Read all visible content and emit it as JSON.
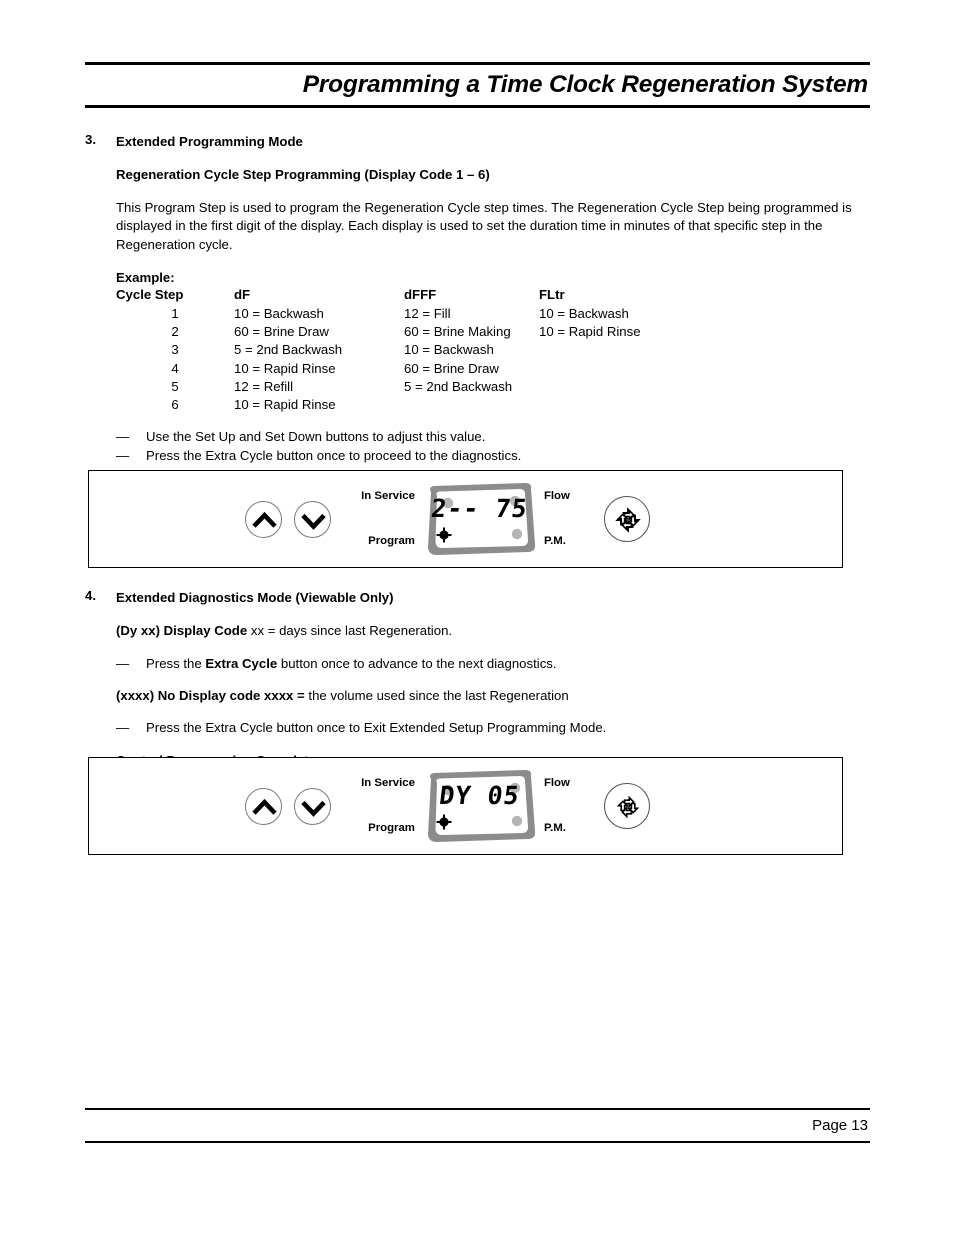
{
  "header": {
    "title": "Programming a Time Clock Regeneration System"
  },
  "section3": {
    "number": "3.",
    "heading": "Extended Programming Mode",
    "subheading": "Regeneration Cycle Step Programming (Display Code 1 – 6)",
    "paragraph": "This Program Step is used to program the Regeneration Cycle step times. The Regeneration Cycle Step being programmed is displayed in the first digit of the display. Each display is used to set the duration time in minutes of that specific step in the Regeneration cycle.",
    "example_label": "Example:",
    "table": {
      "headers": [
        "Cycle Step",
        "dF",
        "dFFF",
        "FLtr"
      ],
      "rows": [
        [
          "1",
          "10 = Backwash",
          "12 = Fill",
          "10 = Backwash"
        ],
        [
          "2",
          "60 = Brine Draw",
          "60 = Brine Making",
          "10 = Rapid Rinse"
        ],
        [
          "3",
          "5 = 2nd Backwash",
          "10 = Backwash",
          ""
        ],
        [
          "4",
          "10 = Rapid Rinse",
          "60 = Brine Draw",
          ""
        ],
        [
          "5",
          "12 = Refill",
          "5 = 2nd Backwash",
          ""
        ],
        [
          "6",
          "10 = Rapid Rinse",
          "",
          ""
        ]
      ]
    },
    "bullets": [
      {
        "dash": "—",
        "text": "Use the Set Up and Set Down buttons to adjust this value."
      },
      {
        "dash": "—",
        "text": "Press the Extra Cycle button once to proceed to the diagnostics."
      }
    ]
  },
  "panel1": {
    "up_button": "set-up",
    "down_button": "set-down",
    "label_in_service": "In Service",
    "label_program": "Program",
    "label_flow": "Flow",
    "label_pm": "P.M.",
    "display_value": "2-- 75",
    "extra_cycle_button": "extra-cycle"
  },
  "section4": {
    "number": "4.",
    "heading": "Extended Diagnostics Mode (Viewable Only)",
    "line1_bold": "(Dy xx) Display Code",
    "line1_rest": " xx = days since last Regeneration.",
    "bullet1": {
      "dash": "—",
      "pre": "Press the ",
      "bold": "Extra Cycle",
      "post": " button once to advance to the next diagnostics."
    },
    "line2_bold": "(xxxx) No Display code xxxx =",
    "line2_rest": " the volume used since the last Regeneration",
    "bullet2": {
      "dash": "—",
      "text": "Press the Extra Cycle button once to Exit Extended Setup Programming Mode."
    },
    "complete": "Control Programming Complete"
  },
  "panel2": {
    "up_button": "set-up",
    "down_button": "set-down",
    "label_in_service": "In Service",
    "label_program": "Program",
    "label_flow": "Flow",
    "label_pm": "P.M.",
    "display_value": "DY 05",
    "extra_cycle_button": "extra-cycle"
  },
  "footer": {
    "page_label": "Page 13"
  },
  "colors": {
    "ink": "#000000",
    "lcd_bezel": "#8c8c8c",
    "lcd_screen": "#ffffff",
    "lcd_dot": "#b5b5b5",
    "button_stroke": "#7a7a7a"
  }
}
